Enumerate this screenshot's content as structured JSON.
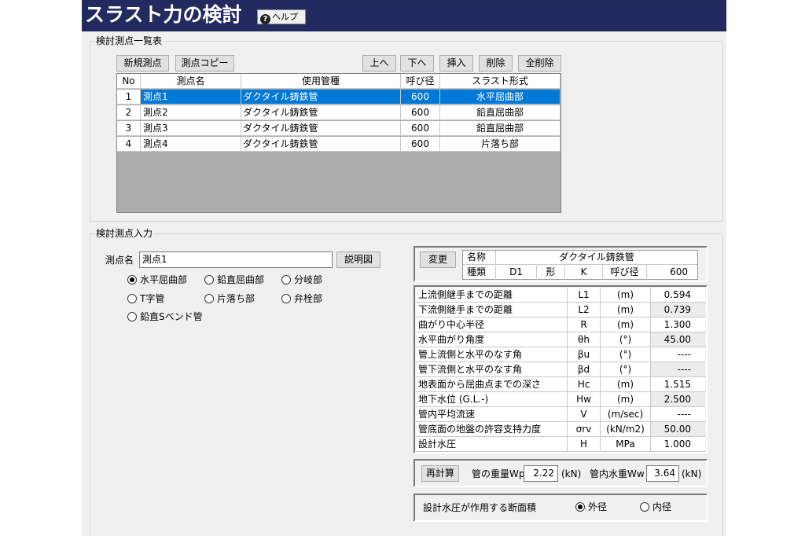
{
  "window": {
    "title": "スラスト力の検討",
    "help_label": "ヘルプ"
  },
  "list_group": {
    "label": "検討測点一覧表",
    "buttons": {
      "new": "新規測点",
      "copy": "測点コピー",
      "up": "上へ",
      "down": "下へ",
      "insert": "挿入",
      "delete": "削除",
      "delete_all": "全削除"
    },
    "columns": [
      "No",
      "測点名",
      "使用管種",
      "呼び径",
      "スラスト形式"
    ],
    "rows": [
      {
        "no": "1",
        "name": "測点1",
        "pipe": "ダクタイル鋳鉄管",
        "diameter": "600",
        "thrust": "水平屈曲部",
        "selected": true
      },
      {
        "no": "2",
        "name": "測点2",
        "pipe": "ダクタイル鋳鉄管",
        "diameter": "600",
        "thrust": "鉛直屈曲部",
        "selected": false
      },
      {
        "no": "3",
        "name": "測点3",
        "pipe": "ダクタイル鋳鉄管",
        "diameter": "600",
        "thrust": "鉛直屈曲部",
        "selected": false
      },
      {
        "no": "4",
        "name": "測点4",
        "pipe": "ダクタイル鋳鉄管",
        "diameter": "600",
        "thrust": "片落ち部",
        "selected": false
      }
    ]
  },
  "input_group": {
    "label": "検討測点入力",
    "point_name_label": "測点名",
    "point_name_value": "測点1",
    "explain_button": "説明図",
    "thrust_types": [
      {
        "label": "水平屈曲部",
        "checked": true
      },
      {
        "label": "鉛直屈曲部",
        "checked": false
      },
      {
        "label": "分岐部",
        "checked": false
      },
      {
        "label": "T字管",
        "checked": false
      },
      {
        "label": "片落ち部",
        "checked": false
      },
      {
        "label": "弁栓部",
        "checked": false
      },
      {
        "label": "鉛直Sベンド管",
        "checked": false
      }
    ]
  },
  "pipe_info": {
    "change_button": "変更",
    "name_label": "名称",
    "name_value": "ダクタイル鋳鉄管",
    "type_label": "種類",
    "type_value": "D1",
    "shape_label": "形",
    "shape_value": "K",
    "diameter_label": "呼び径",
    "diameter_value": "600"
  },
  "params": [
    {
      "label": "上流側継手までの距離",
      "symbol": "L1",
      "unit": "(m)",
      "value": "0.594"
    },
    {
      "label": "下流側継手までの距離",
      "symbol": "L2",
      "unit": "(m)",
      "value": "0.739"
    },
    {
      "label": "曲がり中心半径",
      "symbol": "R",
      "unit": "(m)",
      "value": "1.300"
    },
    {
      "label": "水平曲がり角度",
      "symbol": "θh",
      "unit": "(°)",
      "value": "45.00"
    },
    {
      "label": "管上流側と水平のなす角",
      "symbol": "βu",
      "unit": "(°)",
      "value": "----"
    },
    {
      "label": "管下流側と水平のなす角",
      "symbol": "βd",
      "unit": "(°)",
      "value": "----"
    },
    {
      "label": "地表面から屈曲点までの深さ",
      "symbol": "Hc",
      "unit": "(m)",
      "value": "1.515"
    },
    {
      "label": "地下水位 (G.L.-)",
      "symbol": "Hw",
      "unit": "(m)",
      "value": "2.500"
    },
    {
      "label": "管内平均流速",
      "symbol": "V",
      "unit": "(m/sec)",
      "value": "----"
    },
    {
      "label": "管底面の地盤の許容支持力度",
      "symbol": "σrv",
      "unit": "(kN/m2)",
      "value": "50.00"
    },
    {
      "label": "設計水圧",
      "symbol": "H",
      "unit": "MPa",
      "value": "1.000"
    }
  ],
  "weights": {
    "recalc_button": "再計算",
    "wp_label": "管の重量Wp",
    "wp_value": "2.22",
    "wp_unit": "(kN)",
    "ww_label": "管内水重Ww",
    "ww_value": "3.64",
    "ww_unit": "(kN)"
  },
  "pressure_area": {
    "label": "設計水圧が作用する断面積",
    "options": [
      {
        "label": "外径",
        "checked": true
      },
      {
        "label": "内径",
        "checked": false
      }
    ]
  }
}
